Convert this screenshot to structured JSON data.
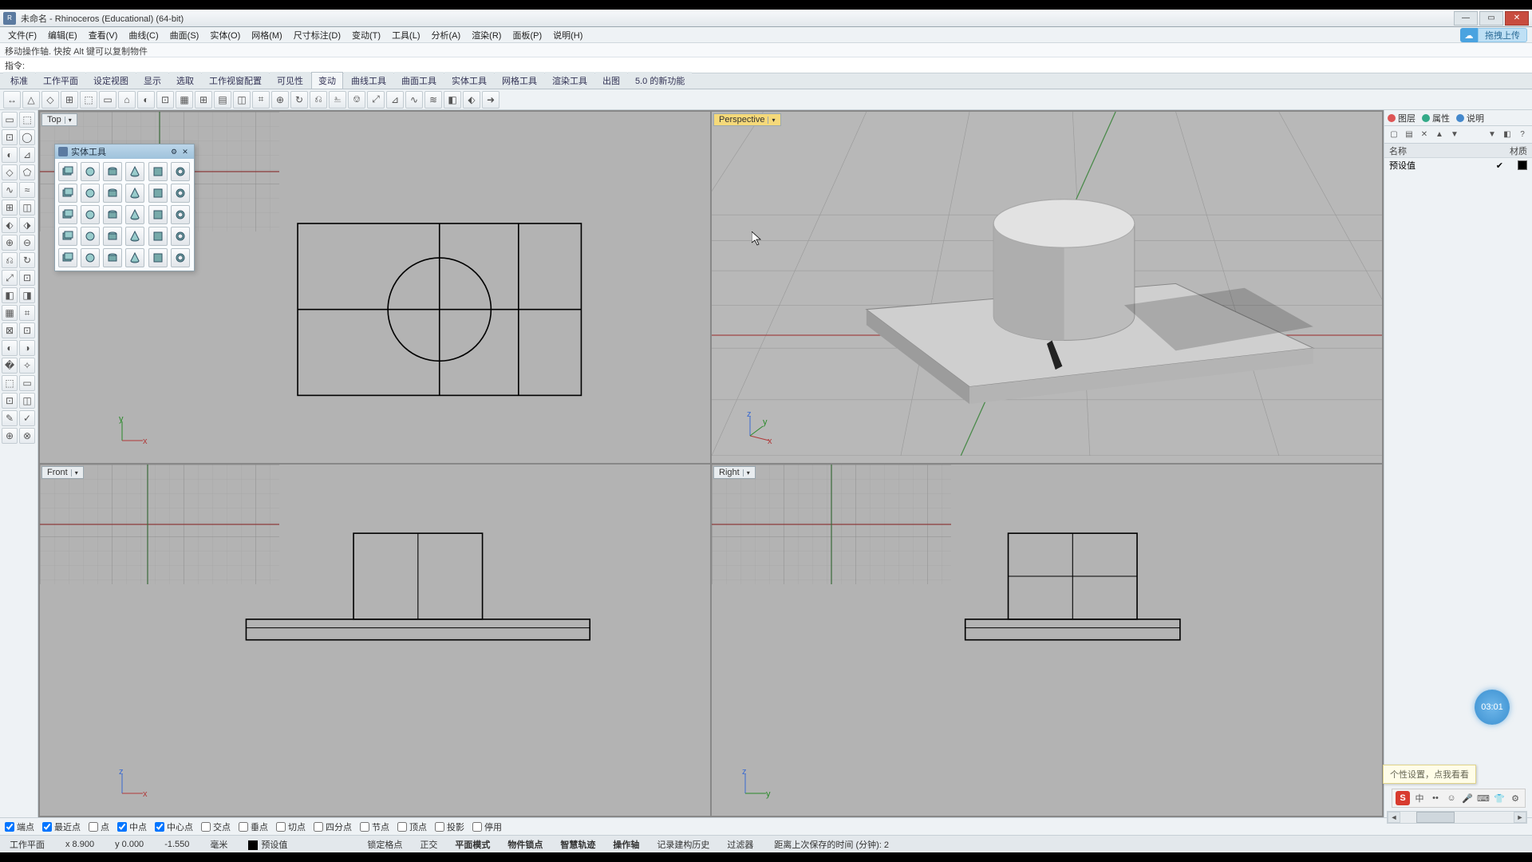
{
  "title": "未命名 - Rhinoceros (Educational) (64-bit)",
  "menu": [
    "文件(F)",
    "编辑(E)",
    "查看(V)",
    "曲线(C)",
    "曲面(S)",
    "实体(O)",
    "网格(M)",
    "尺寸标注(D)",
    "变动(T)",
    "工具(L)",
    "分析(A)",
    "渲染(R)",
    "面板(P)",
    "说明(H)"
  ],
  "cloud_button": "拖拽上传",
  "history_line": "移动操作轴. 快按 Alt 键可以复制物件",
  "command_label": "指令:",
  "command_value": "",
  "tabs": [
    "标准",
    "工作平面",
    "设定视图",
    "显示",
    "选取",
    "工作视窗配置",
    "可见性",
    "变动",
    "曲线工具",
    "曲面工具",
    "实体工具",
    "网格工具",
    "渲染工具",
    "出图",
    "5.0 的新功能"
  ],
  "active_tab_index": 7,
  "float_panel_title": "实体工具",
  "viewports": {
    "top": "Top",
    "perspective": "Perspective",
    "front": "Front",
    "right": "Right"
  },
  "right_panel": {
    "tabs": [
      {
        "label": "图层",
        "color": "#d55"
      },
      {
        "label": "属性",
        "color": "#3a8"
      },
      {
        "label": "说明",
        "color": "#48c"
      }
    ],
    "col_name": "名称",
    "col_material": "材质",
    "row_label": "预设值"
  },
  "osnaps": [
    {
      "label": "端点",
      "checked": true
    },
    {
      "label": "最近点",
      "checked": true
    },
    {
      "label": "点",
      "checked": false
    },
    {
      "label": "中点",
      "checked": true
    },
    {
      "label": "中心点",
      "checked": true
    },
    {
      "label": "交点",
      "checked": false
    },
    {
      "label": "垂点",
      "checked": false
    },
    {
      "label": "切点",
      "checked": false
    },
    {
      "label": "四分点",
      "checked": false
    },
    {
      "label": "节点",
      "checked": false
    },
    {
      "label": "顶点",
      "checked": false
    },
    {
      "label": "投影",
      "checked": false
    },
    {
      "label": "停用",
      "checked": false
    }
  ],
  "status": {
    "cplane": "工作平面",
    "x": "x 8.900",
    "y": "y 0.000",
    "z": "-1.550",
    "unit": "毫米",
    "layer": "预设值",
    "toggles": [
      "锁定格点",
      "正交",
      "平面模式",
      "物件锁点",
      "智慧轨迹",
      "操作轴",
      "记录建构历史",
      "过滤器"
    ],
    "bold_toggles": [
      "平面模式",
      "物件锁点",
      "智慧轨迹",
      "操作轴"
    ],
    "autosave": "距离上次保存的时间 (分钟): 2"
  },
  "ime_tip": "个性设置，点我看看",
  "timer": "03:01"
}
